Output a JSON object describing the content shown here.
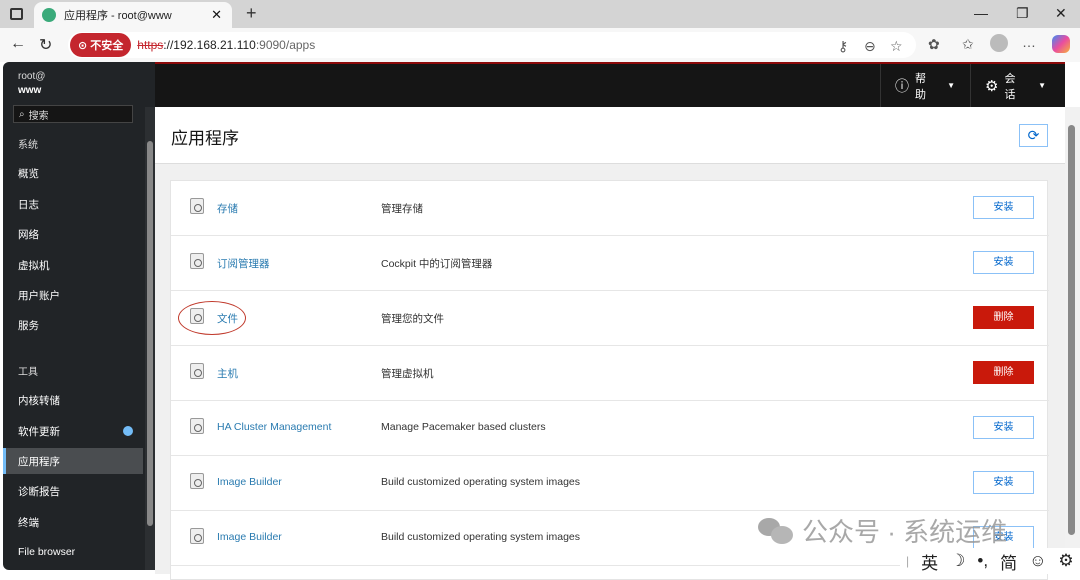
{
  "browser": {
    "tab_title": "应用程序 - root@www",
    "url_scheme": "https",
    "url_host": "://192.168.21.110",
    "url_rest": ":9090/apps",
    "insecure_label": "不安全"
  },
  "header": {
    "help": "帮助",
    "session": "会话"
  },
  "sidebar": {
    "host_user": "root@",
    "host_name": "www",
    "search_placeholder": "搜索",
    "items": [
      {
        "label": "系统",
        "type": "head"
      },
      {
        "label": "概览"
      },
      {
        "label": "日志"
      },
      {
        "label": "网络"
      },
      {
        "label": "虚拟机"
      },
      {
        "label": "用户账户"
      },
      {
        "label": "服务"
      },
      {
        "label": "工具",
        "type": "head"
      },
      {
        "label": "内核转储"
      },
      {
        "label": "软件更新",
        "badge": true
      },
      {
        "label": "应用程序",
        "active": true
      },
      {
        "label": "诊断报告"
      },
      {
        "label": "终端"
      },
      {
        "label": "File browser"
      }
    ]
  },
  "main": {
    "title": "应用程序",
    "apps": [
      {
        "name": "存储",
        "desc": "管理存储",
        "action": "安装",
        "kind": "install"
      },
      {
        "name": "订阅管理器",
        "desc": "Cockpit 中的订阅管理器",
        "action": "安装",
        "kind": "install"
      },
      {
        "name": "文件",
        "desc": "管理您的文件",
        "action": "删除",
        "kind": "remove",
        "highlighted": true
      },
      {
        "name": "主机",
        "desc": "管理虚拟机",
        "action": "删除",
        "kind": "remove"
      },
      {
        "name": "HA Cluster Management",
        "desc": "Manage Pacemaker based clusters",
        "action": "安装",
        "kind": "install"
      },
      {
        "name": "Image Builder",
        "desc": "Build customized operating system images",
        "action": "安装",
        "kind": "install"
      },
      {
        "name": "Image Builder",
        "desc": "Build customized operating system images",
        "action": "安装",
        "kind": "install"
      }
    ]
  },
  "watermark": "公众号 · 系统运维",
  "ime": {
    "lang": "英",
    "mode": "简"
  },
  "colors": {
    "accent": "#06c",
    "danger": "#c9190b",
    "sidebar": "#212427",
    "header": "#151515"
  }
}
